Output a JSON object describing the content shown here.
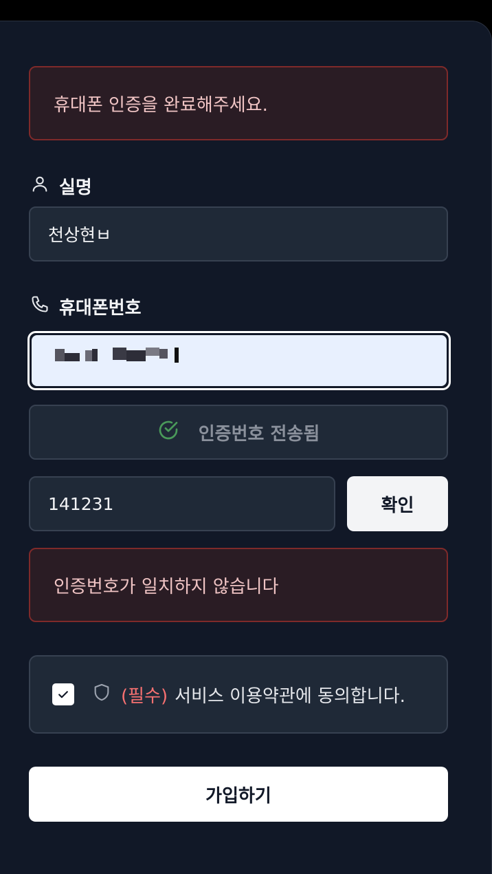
{
  "alerts": {
    "top_message": "휴대폰 인증을 완료해주세요.",
    "code_error": "인증번호가 일치하지 않습니다"
  },
  "name": {
    "label": "실명",
    "value": "천상현ㅂ",
    "icon": "user-icon"
  },
  "phone": {
    "label": "휴대폰번호",
    "icon": "phone-icon",
    "value_redacted": true
  },
  "verification": {
    "sent_label": "인증번호 전송됨",
    "sent_icon": "check-circle-icon",
    "code_value": "141231",
    "confirm_label": "확인"
  },
  "terms": {
    "checked": true,
    "required_tag": "(필수)",
    "text": "서비스 이용약관에 동의합니다.",
    "icon": "shield-icon"
  },
  "signup": {
    "label": "가입하기"
  },
  "colors": {
    "background": "#111827",
    "error_border": "#7f2a2a",
    "error_text": "#f0c4c4",
    "required": "#f87171",
    "success_icon": "#4a9a5a"
  }
}
